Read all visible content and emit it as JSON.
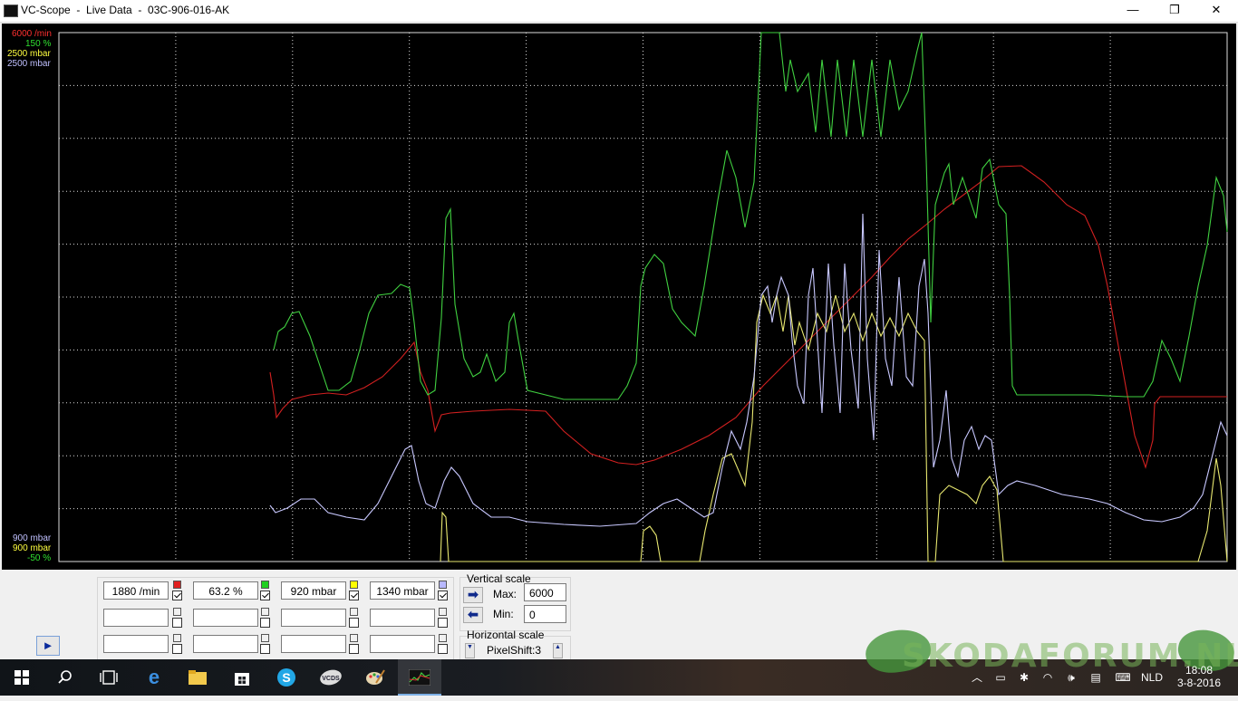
{
  "window": {
    "title": "VC-Scope  -  Live Data  -  03C-906-016-AK",
    "minimize": "—",
    "maximize": "❐",
    "close": "✕"
  },
  "scope": {
    "top_labels": [
      {
        "text": "6000 /min",
        "color": "#ff3030"
      },
      {
        "text": "150 %",
        "color": "#30e030"
      },
      {
        "text": "2500 mbar",
        "color": "#ffff40"
      },
      {
        "text": "2500 mbar",
        "color": "#c0c0ff"
      }
    ],
    "bottom_labels": [
      {
        "text": "900 mbar",
        "color": "#c0c0ff"
      },
      {
        "text": "900 mbar",
        "color": "#ffff40"
      },
      {
        "text": "-50 %",
        "color": "#30e030"
      }
    ],
    "colors": {
      "rpm": "#d22020",
      "pct": "#40d040",
      "boost": "#e8e870",
      "map": "#c8c8ff",
      "grid": "#dcdcdc"
    }
  },
  "channels": [
    {
      "value": "1880 /min",
      "color": "#e02020",
      "checked": true
    },
    {
      "value": "63.2 %",
      "color": "#20d020",
      "checked": true
    },
    {
      "value": "920 mbar",
      "color": "#ffff00",
      "checked": true
    },
    {
      "value": "1340 mbar",
      "color": "#b8b8ff",
      "checked": true
    }
  ],
  "empty_rows": [
    [
      "",
      "",
      "",
      ""
    ],
    [
      "",
      "",
      "",
      ""
    ]
  ],
  "vertical_scale": {
    "label": "Vertical scale",
    "max_label": "Max:",
    "max_value": "6000",
    "min_label": "Min:",
    "min_value": "0",
    "up_icon": "➡",
    "down_icon": "⬅"
  },
  "horizontal_scale": {
    "label": "Horizontal scale",
    "value": "PixelShift:3",
    "left_icon": "▼",
    "right_icon": "▲"
  },
  "run_button": "►",
  "taskbar": {
    "items": [
      "start-icon",
      "search-icon",
      "task-view-icon",
      "edge-icon",
      "file-explorer-icon",
      "store-icon",
      "skype-icon",
      "vcds-icon",
      "paint-icon",
      "vc-scope-icon"
    ],
    "language": "NLD",
    "time": "18:08",
    "date": "3-8-2016"
  },
  "watermark": "SKODAFORUM.NL"
}
